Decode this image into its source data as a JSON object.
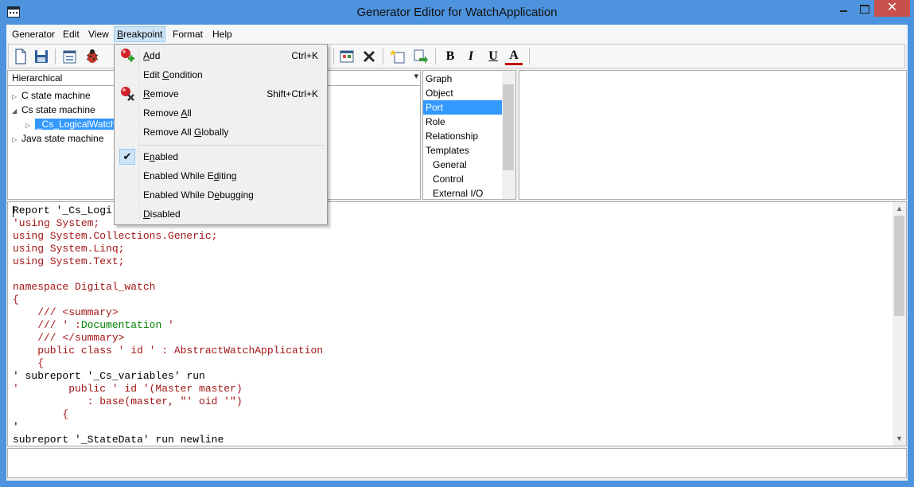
{
  "window": {
    "title": "Generator Editor for WatchApplication",
    "close_glyph": "✕"
  },
  "menubar": {
    "items": [
      "Generator",
      "Edit",
      "View",
      "Breakpoint",
      "Format",
      "Help"
    ],
    "active": "Breakpoint"
  },
  "toolbar": {
    "buttons": [
      "new-document",
      "save",
      "properties",
      "debug-bug",
      "breakpoint-add",
      "cut",
      "copy",
      "paste",
      "undo",
      "generate-settings",
      "delete",
      "add-item",
      "move-item",
      "bold",
      "italic",
      "underline",
      "font-color"
    ],
    "bold_label": "B",
    "italic_label": "I",
    "underline_label": "U",
    "color_label": "A",
    "accent_color": "#c00000"
  },
  "hierarchy": {
    "view": "Hierarchical",
    "nodes": [
      {
        "label": "C state machine",
        "expander": "▷"
      },
      {
        "label": "Cs state machine",
        "expander": "◢"
      },
      {
        "label": "_Cs_LogicalWatch",
        "expander": "▷",
        "selected": true
      },
      {
        "label": "Java state machine",
        "expander": "▷"
      }
    ]
  },
  "typelist": {
    "items": [
      "Graph",
      "Object",
      "Port",
      "Role",
      "Relationship",
      "Templates",
      "General",
      "Control",
      "External I/O"
    ],
    "selected": "Port"
  },
  "breakpoint_menu": {
    "items": [
      {
        "label": "Add",
        "mnemonic_index": 0,
        "shortcut": "Ctrl+K",
        "icon": "add-breakpoint-icon"
      },
      {
        "label": "Edit Condition",
        "mnemonic_index": 5,
        "shortcut": ""
      },
      {
        "label": "Remove",
        "mnemonic_index": 0,
        "shortcut": "Shift+Ctrl+K",
        "icon": "remove-breakpoint-icon"
      },
      {
        "label": "Remove All",
        "mnemonic_index": 7,
        "shortcut": ""
      },
      {
        "label": "Remove All Globally",
        "mnemonic_index": 11,
        "shortcut": ""
      },
      {
        "label": "Enabled",
        "mnemonic_index": 1,
        "shortcut": "",
        "checked": true
      },
      {
        "label": "Enabled While Editing",
        "mnemonic_index": 15,
        "shortcut": ""
      },
      {
        "label": "Enabled While Debugging",
        "mnemonic_index": 15,
        "shortcut": ""
      },
      {
        "label": "Disabled",
        "mnemonic_index": 0,
        "shortcut": ""
      }
    ],
    "check_glyph": "✔"
  },
  "code": {
    "lines": [
      {
        "text": "Report '_Cs_Logi",
        "color": "black"
      },
      {
        "text": "'using System;",
        "color": "red"
      },
      {
        "text": "using System.Collections.Generic;",
        "color": "red"
      },
      {
        "text": "using System.Linq;",
        "color": "red"
      },
      {
        "text": "using System.Text;",
        "color": "red"
      },
      {
        "text": "",
        "color": "red"
      },
      {
        "text": "namespace Digital_watch",
        "color": "red"
      },
      {
        "text": "{",
        "color": "red"
      },
      {
        "text": "    /// <summary>",
        "color": "red"
      },
      {
        "text": "    /// ' :",
        "color": "red",
        "tail": "Documentation",
        "tail_color": "green",
        "after": " '"
      },
      {
        "text": "    /// </summary>",
        "color": "red"
      },
      {
        "text": "    public class ' id ' : AbstractWatchApplication",
        "color": "red"
      },
      {
        "text": "    {",
        "color": "red"
      },
      {
        "text": "' subreport '_Cs_variables' run",
        "color": "black"
      },
      {
        "text": "'        public ' id '(Master master)",
        "color": "red"
      },
      {
        "text": "            : base(master, \"' oid '\")",
        "color": "red"
      },
      {
        "text": "        {",
        "color": "red"
      },
      {
        "text": "'",
        "color": "black"
      },
      {
        "text": "subreport '_StateData' run newline",
        "color": "black"
      }
    ]
  },
  "scroll": {
    "up": "▲",
    "down": "▼",
    "dropdown": "▾"
  }
}
